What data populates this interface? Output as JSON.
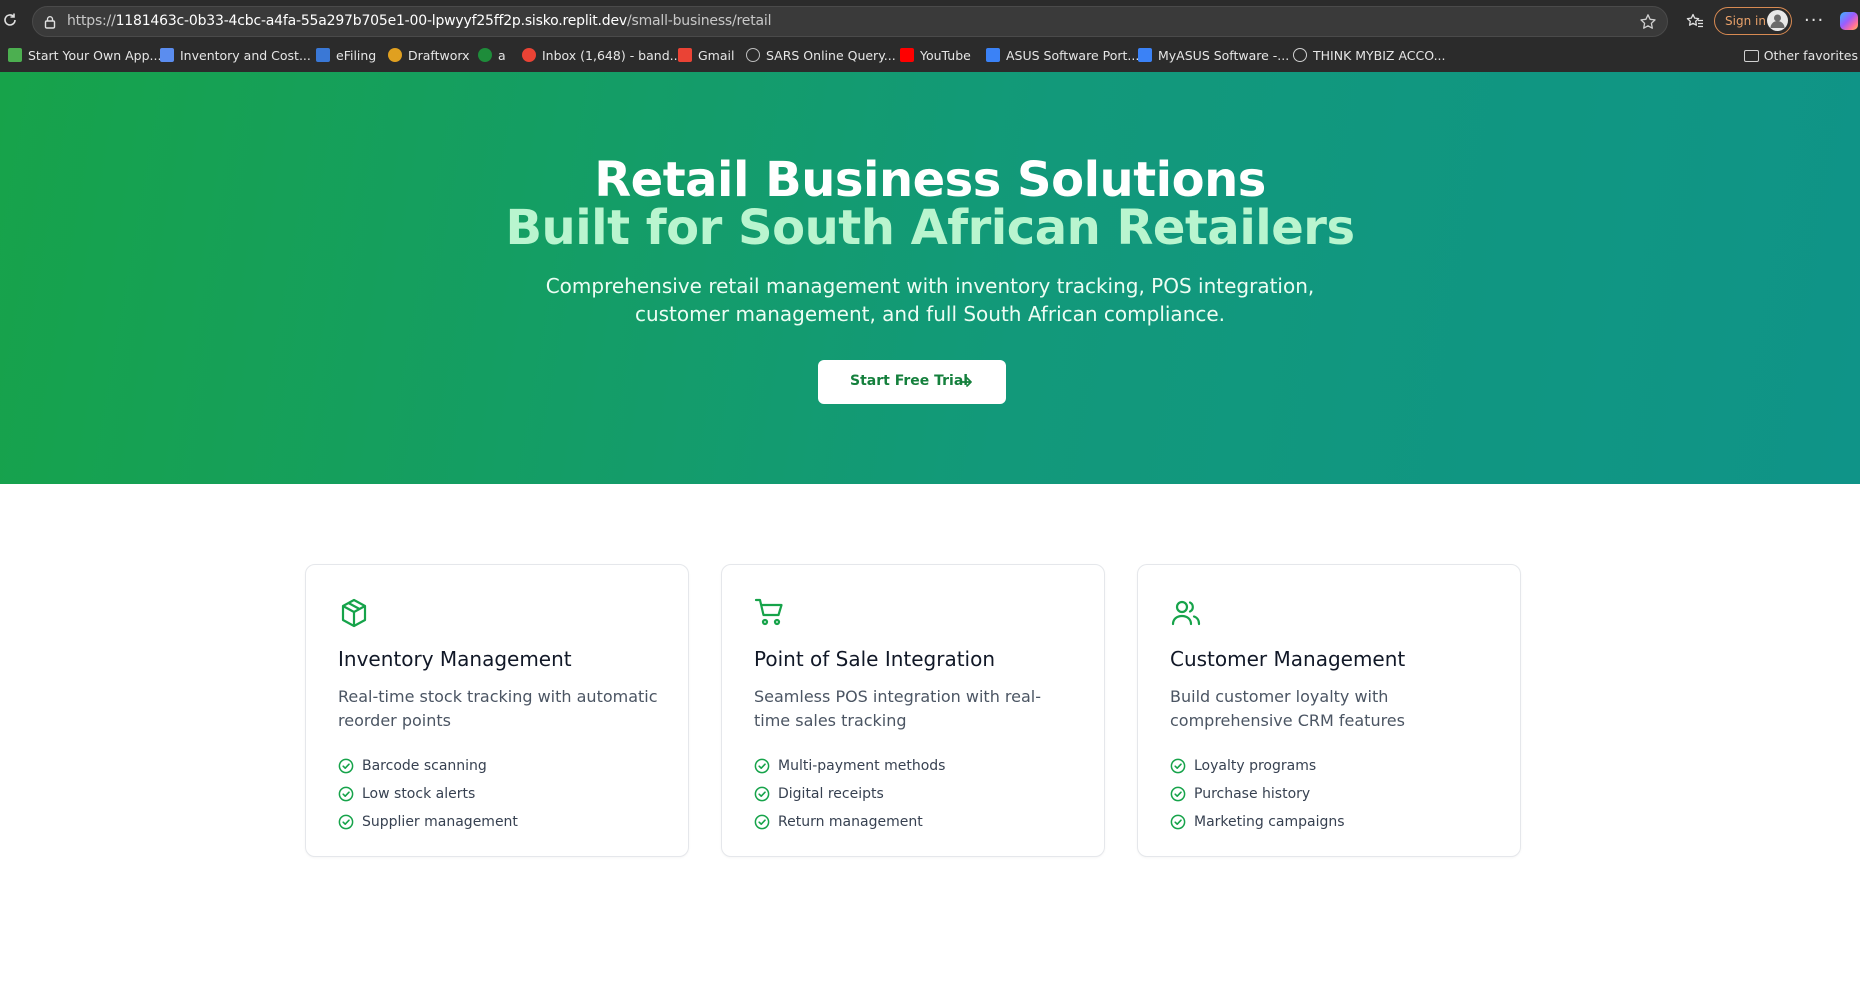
{
  "browser": {
    "url_prefix": "https://",
    "url_host": "1181463c-0b33-4cbc-a4fa-55a297b705e1-00-lpwyyf25ff2p.sisko.replit.dev",
    "url_path": "/small-business/retail",
    "sign_in_label": "Sign in",
    "more_label": "···"
  },
  "bookmarks": {
    "items": [
      {
        "label": "Start Your Own App...",
        "icon": "app-icon",
        "color": "#4caf50"
      },
      {
        "label": "Inventory and Cost...",
        "icon": "ac-icon",
        "color": "#5b8def"
      },
      {
        "label": "eFiling",
        "icon": "efiling-icon",
        "color": "#3a78d6"
      },
      {
        "label": "Draftworx",
        "icon": "draftworx-icon",
        "color": "#e0a020"
      },
      {
        "label": "a",
        "icon": "bookmark-a-icon",
        "color": "#1e8c3a"
      },
      {
        "label": "Inbox (1,648) - band...",
        "icon": "google-icon",
        "color": "#ea4335"
      },
      {
        "label": "Gmail",
        "icon": "gmail-icon",
        "color": "#ea4335"
      },
      {
        "label": "SARS Online Query...",
        "icon": "globe-icon",
        "color": "#bdbdbd"
      },
      {
        "label": "YouTube",
        "icon": "youtube-icon",
        "color": "#ff0000"
      },
      {
        "label": "ASUS Software Port...",
        "icon": "asus-icon",
        "color": "#3b82f6"
      },
      {
        "label": "MyASUS Software -...",
        "icon": "myasus-icon",
        "color": "#3b82f6"
      },
      {
        "label": "THINK MYBIZ ACCO...",
        "icon": "thinkmybiz-icon",
        "color": "#d0d0d0"
      }
    ],
    "other_label": "Other favorites"
  },
  "hero": {
    "title_line1": "Retail Business Solutions",
    "title_line2": "Built for South African Retailers",
    "subtitle": "Comprehensive retail management with inventory tracking, POS integration, customer management, and full South African compliance.",
    "cta_label": "Start Free Trial"
  },
  "cards": [
    {
      "icon": "package-icon",
      "title": "Inventory Management",
      "description": "Real-time stock tracking with automatic reorder points",
      "features": [
        "Barcode scanning",
        "Low stock alerts",
        "Supplier management"
      ]
    },
    {
      "icon": "shopping-cart-icon",
      "title": "Point of Sale Integration",
      "description": "Seamless POS integration with real-time sales tracking",
      "features": [
        "Multi-payment methods",
        "Digital receipts",
        "Return management"
      ]
    },
    {
      "icon": "users-icon",
      "title": "Customer Management",
      "description": "Build customer loyalty with comprehensive CRM features",
      "features": [
        "Loyalty programs",
        "Purchase history",
        "Marketing campaigns"
      ]
    }
  ],
  "colors": {
    "accent_green": "#16a34a",
    "hero_gradient_start": "#17a34a",
    "hero_gradient_end": "#0f9488",
    "hero_title_highlight": "#b9f5cf"
  }
}
